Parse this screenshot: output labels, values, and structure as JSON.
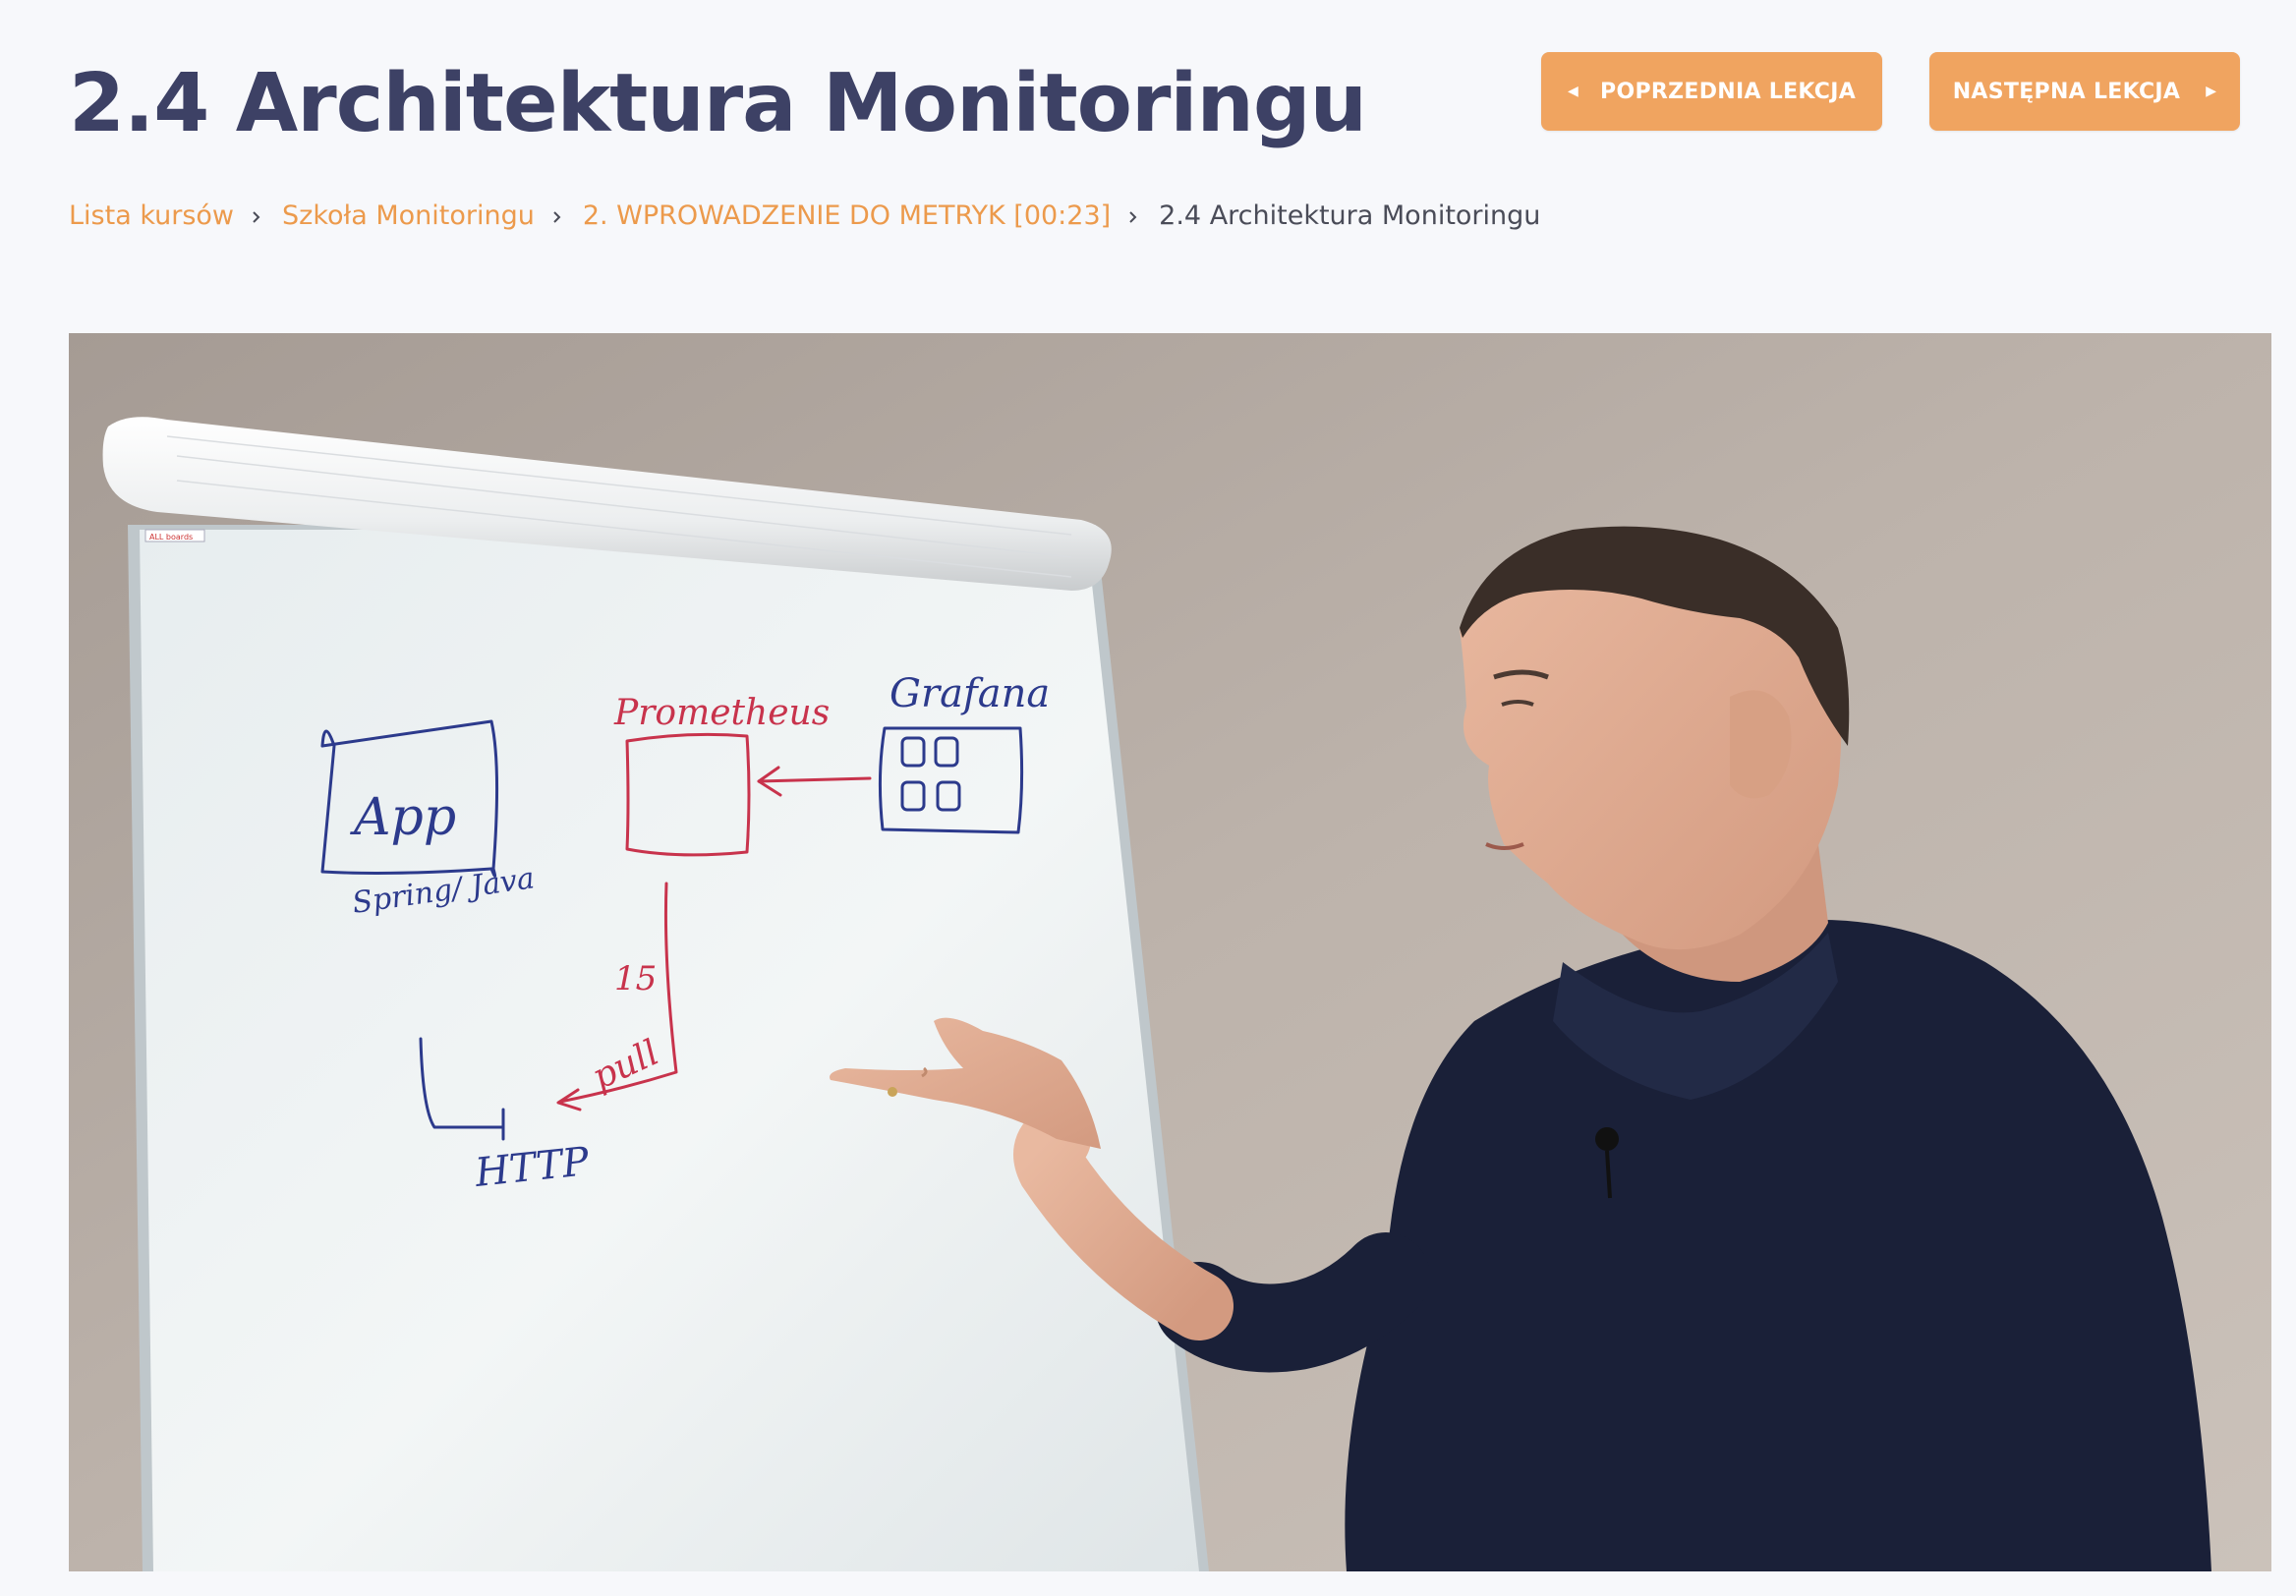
{
  "lesson": {
    "title": "2.4 Architektura Monitoringu"
  },
  "navigation": {
    "prev_label": "POPRZEDNIA LEKCJA",
    "next_label": "NASTĘPNA LEKCJA",
    "prev_icon": "caret-left-icon",
    "next_icon": "caret-right-icon"
  },
  "breadcrumb": {
    "items": [
      "Lista kursów",
      "Szkoła Monitoringu",
      "2. WPROWADZENIE DO METRYK [00:23]"
    ],
    "current": "2.4 Architektura Monitoringu",
    "separator_icon": "chevron-right-icon"
  },
  "video": {
    "whiteboard": {
      "labels": {
        "app": "App",
        "stack": "Spring/ Java",
        "prometheus": "Prometheus",
        "grafana": "Grafana",
        "every": "15",
        "pull": "pull",
        "protocol": "HTTP",
        "brand": "ALL boards"
      }
    }
  },
  "colors": {
    "title": "#3d4165",
    "accent": "#f0a460",
    "link": "#ec9a4c",
    "background": "#f7f8fb",
    "marker_blue": "#2c3a8c",
    "marker_red": "#c8334c"
  }
}
